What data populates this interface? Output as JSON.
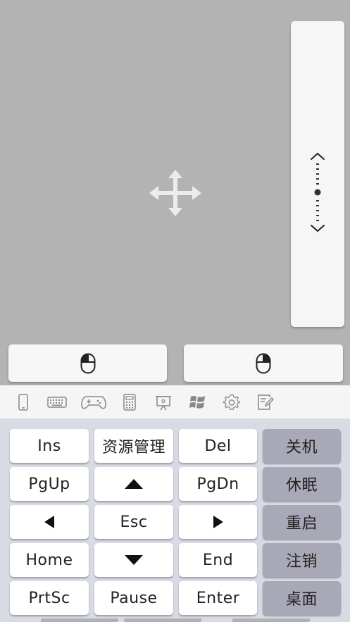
{
  "tabs": [
    {
      "name": "phone-icon"
    },
    {
      "name": "keyboard-icon"
    },
    {
      "name": "gamepad-icon"
    },
    {
      "name": "calculator-icon"
    },
    {
      "name": "presentation-icon"
    },
    {
      "name": "windows-icon"
    },
    {
      "name": "gear-icon"
    },
    {
      "name": "notes-icon"
    }
  ],
  "keys": {
    "ins": "Ins",
    "explorer": "资源管理",
    "del": "Del",
    "shutdown": "关机",
    "pgup": "PgUp",
    "pgdn": "PgDn",
    "sleep": "休眠",
    "esc": "Esc",
    "restart": "重启",
    "home": "Home",
    "end": "End",
    "logout": "注销",
    "prtsc": "PrtSc",
    "pause": "Pause",
    "enter": "Enter",
    "desktop": "桌面"
  },
  "colors": {
    "touchpad": "#b3b3b3",
    "key": "#ffffff",
    "system_key": "#a8a8b6",
    "keypad_bg": "#d8dbe4"
  }
}
